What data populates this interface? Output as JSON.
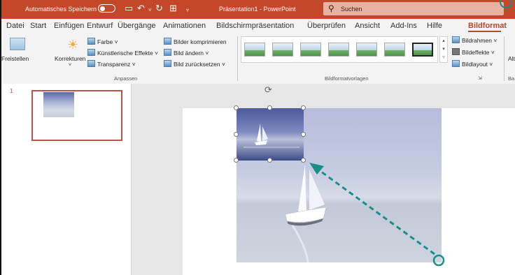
{
  "titlebar": {
    "autosave_label": "Automatisches Speichern",
    "document_title": "Präsentation1  -  PowerPoint",
    "search_placeholder": "Suchen"
  },
  "tabs": [
    "Datei",
    "Start",
    "Einfügen",
    "Entwurf",
    "Übergänge",
    "Animationen",
    "Bildschirmpräsentation",
    "Überprüfen",
    "Ansicht",
    "Add-Ins",
    "Hilfe",
    "Bildformat"
  ],
  "active_tab": "Bildformat",
  "ribbon": {
    "freistellen": "Freistellen",
    "korrekturen": "Korrekturen",
    "farbe": "Farbe ˅",
    "kuenstlerisch": "Künstlerische Effekte ˅",
    "transparenz": "Transparenz ˅",
    "komprimieren": "Bilder komprimieren",
    "aendern": "Bild ändern ˅",
    "zuruecksetzen": "Bild zurücksetzen  ˅",
    "group_anpassen": "Anpassen",
    "group_bildformatvorlagen": "Bildformatvorlagen",
    "bildrahmen": "Bildrahmen ˅",
    "bildeffekte": "Bildeffekte ˅",
    "bildlayout": "Bildlayout ˅",
    "alt_cut": "Alt",
    "ba_cut": "Ba"
  },
  "slides_panel": {
    "slide_number": "1"
  },
  "colors": {
    "titlebar": "#c4472a",
    "accent": "#b7472a",
    "arrow": "#17908a"
  }
}
